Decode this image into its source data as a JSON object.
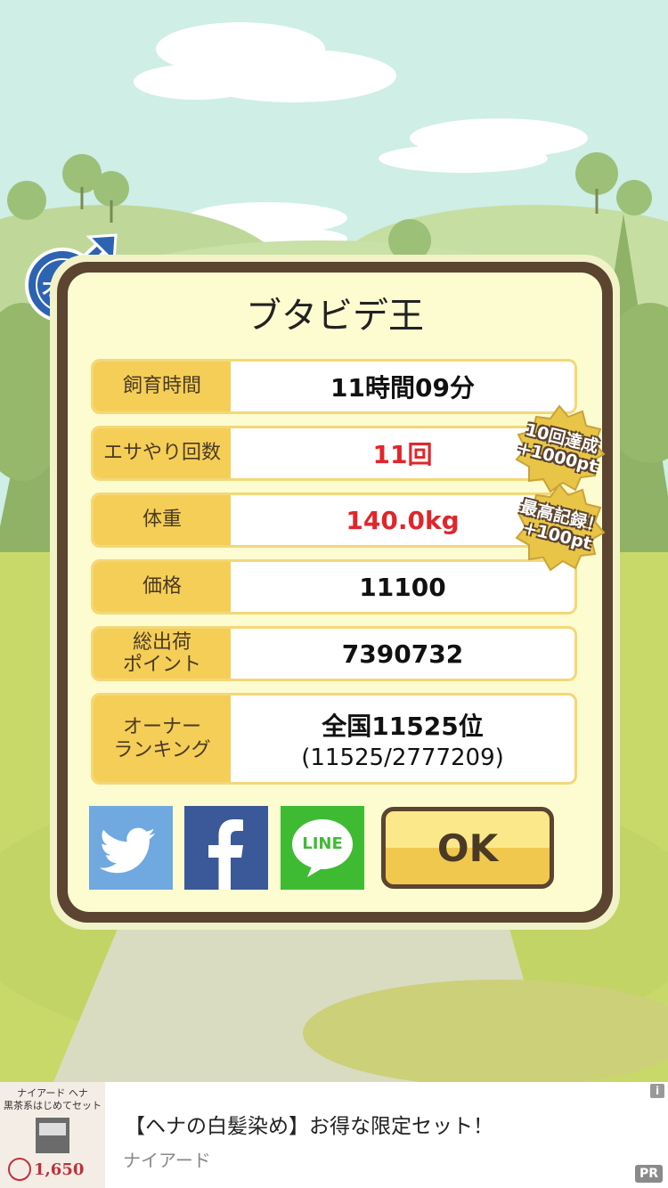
{
  "pig_name": "ブタビデ王",
  "gender_badge": "オス",
  "stats": [
    {
      "label": "飼育時間",
      "value": "11時間09分",
      "sub": ""
    },
    {
      "label": "エサやり回数",
      "value": "11回",
      "sub": ""
    },
    {
      "label": "体重",
      "value": "140.0kg",
      "sub": ""
    },
    {
      "label": "価格",
      "value": "11100",
      "sub": ""
    },
    {
      "label": "総出荷\nポイント",
      "value": "7390732",
      "sub": ""
    },
    {
      "label": "オーナー\nランキング",
      "value": "全国11525位",
      "sub": "(11525/2777209)"
    }
  ],
  "badges": [
    {
      "line1": "10回達成",
      "line2": "+1000pt"
    },
    {
      "line1": "最高記録！",
      "line2": "+100pt"
    }
  ],
  "buttons": {
    "ok": "OK",
    "line": "LINE"
  },
  "ad": {
    "thumb_text": "ナイアード ヘナ\n黒茶系はじめてセット",
    "thumb_price": "1,650",
    "title": "【ヘナの白髪染め】お得な限定セット！",
    "source": "ナイアード",
    "info": "i",
    "pr": "PR"
  },
  "colors": {
    "accent_red": "#e0262b",
    "label_yellow": "#f5ce57",
    "frame_brown": "#5b4430",
    "twitter": "#6fa9e0",
    "facebook": "#3b5998",
    "line": "#3fbb33"
  },
  "icons": [
    "male-symbol-icon",
    "twitter-bird-icon",
    "facebook-f-icon",
    "line-bubble-icon"
  ]
}
